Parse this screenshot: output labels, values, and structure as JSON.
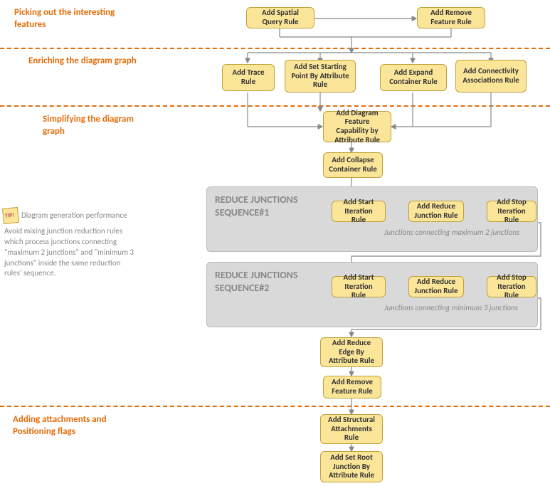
{
  "sections": {
    "s1": "Picking out the interesting features",
    "s2": "Enriching the diagram graph",
    "s3": "Simplifying the diagram graph",
    "s4": "Adding attachments and Positioning flags"
  },
  "nodes": {
    "spatial_query": "Add Spatial Query Rule",
    "remove_feature_top": "Add Remove Feature Rule",
    "trace": "Add Trace Rule",
    "starting_point": "Add Set  Starting Point By Attribute Rule",
    "expand_container": "Add Expand Container Rule",
    "connectivity": "Add Connectivity Associations Rule",
    "feature_capability": "Add Diagram Feature Capability by Attribute Rule",
    "collapse_container": "Add Collapse Container Rule",
    "start_iter_1": "Add Start Iteration Rule",
    "reduce_junc_1": "Add Reduce Junction Rule",
    "stop_iter_1": "Add Stop Iteration Rule",
    "start_iter_2": "Add Start Iteration Rule",
    "reduce_junc_2": "Add Reduce Junction Rule",
    "stop_iter_2": "Add Stop Iteration Rule",
    "reduce_edge": "Add Reduce Edge By Attribute Rule",
    "remove_feature_bottom": "Add Remove Feature Rule",
    "structural_attachments": "Add Structural Attachments Rule",
    "set_root": "Add Set Root Junction By Attribute Rule"
  },
  "seq": {
    "title1_a": "REDUCE JUNCTIONS",
    "title1_b": "SEQUENCE#1",
    "note1": "Junctions connecting maximum 2 junctions",
    "title2_a": "REDUCE JUNCTIONS",
    "title2_b": "SEQUENCE#2",
    "note2": "Junctions connecting minimum 3 junctions"
  },
  "tip": {
    "title": "Diagram generation performance",
    "body": "Avoid mixing junction reduction rules which process junctions connecting \"maximum 2 junctions\" and \"minimum 3 junctions\" inside the same reduction rules' sequence."
  }
}
